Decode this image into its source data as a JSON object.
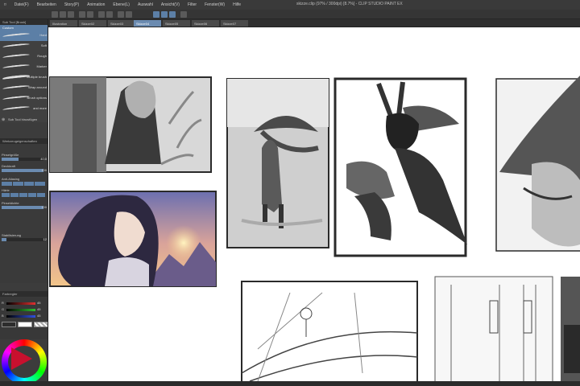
{
  "window": {
    "title": "skizze.clip (97% / 300dpi) [8.7%] - CLIP STUDIO PAINT EX"
  },
  "menu": [
    "Datei(F)",
    "Bearbeiten",
    "Story(P)",
    "Animation",
    "Ebene(L)",
    "Auswahl",
    "Ansicht(V)",
    "Filter",
    "Fenster(W)",
    "Hilfe"
  ],
  "tabs": [
    "Illustration",
    "Skizze02",
    "Skizze03",
    "Skizze04",
    "Skizze05",
    "Skizze06",
    "Skizze07"
  ],
  "sub_tool": {
    "header": "Sub Tool [Brush]",
    "group": "Custom",
    "brushes": [
      "Hard",
      "Soft",
      "Rough",
      "Marker",
      "Multiple brush",
      "Wrap around",
      "Brush options",
      "and more"
    ],
    "add_label": "Sub Tool hinzufügen"
  },
  "tool_property": {
    "header": "Werkzeugeigenschaften",
    "props": [
      {
        "label": "Pinselgröße",
        "value": "40.0",
        "fill": 0.4
      },
      {
        "label": "Deckkraft",
        "value": "100",
        "fill": 1.0
      },
      {
        "label": "Anti-Aliasing",
        "value": "",
        "fill": 0
      },
      {
        "label": "Härte",
        "value": "",
        "fill": 0
      },
      {
        "label": "Pinseldichte",
        "value": "100",
        "fill": 1.0
      },
      {
        "label": "Stabilisierung",
        "value": "12",
        "fill": 0.12
      }
    ]
  },
  "color": {
    "header": "Farbregler",
    "channels": [
      {
        "label": "R",
        "value": "45",
        "color": "#e03030"
      },
      {
        "label": "G",
        "value": "45",
        "color": "#30c030"
      },
      {
        "label": "B",
        "value": "45",
        "color": "#3050e0"
      }
    ],
    "main_color": "#2d2d2d",
    "sub_color": "#ffffff"
  },
  "accent": "#5c7fa6"
}
